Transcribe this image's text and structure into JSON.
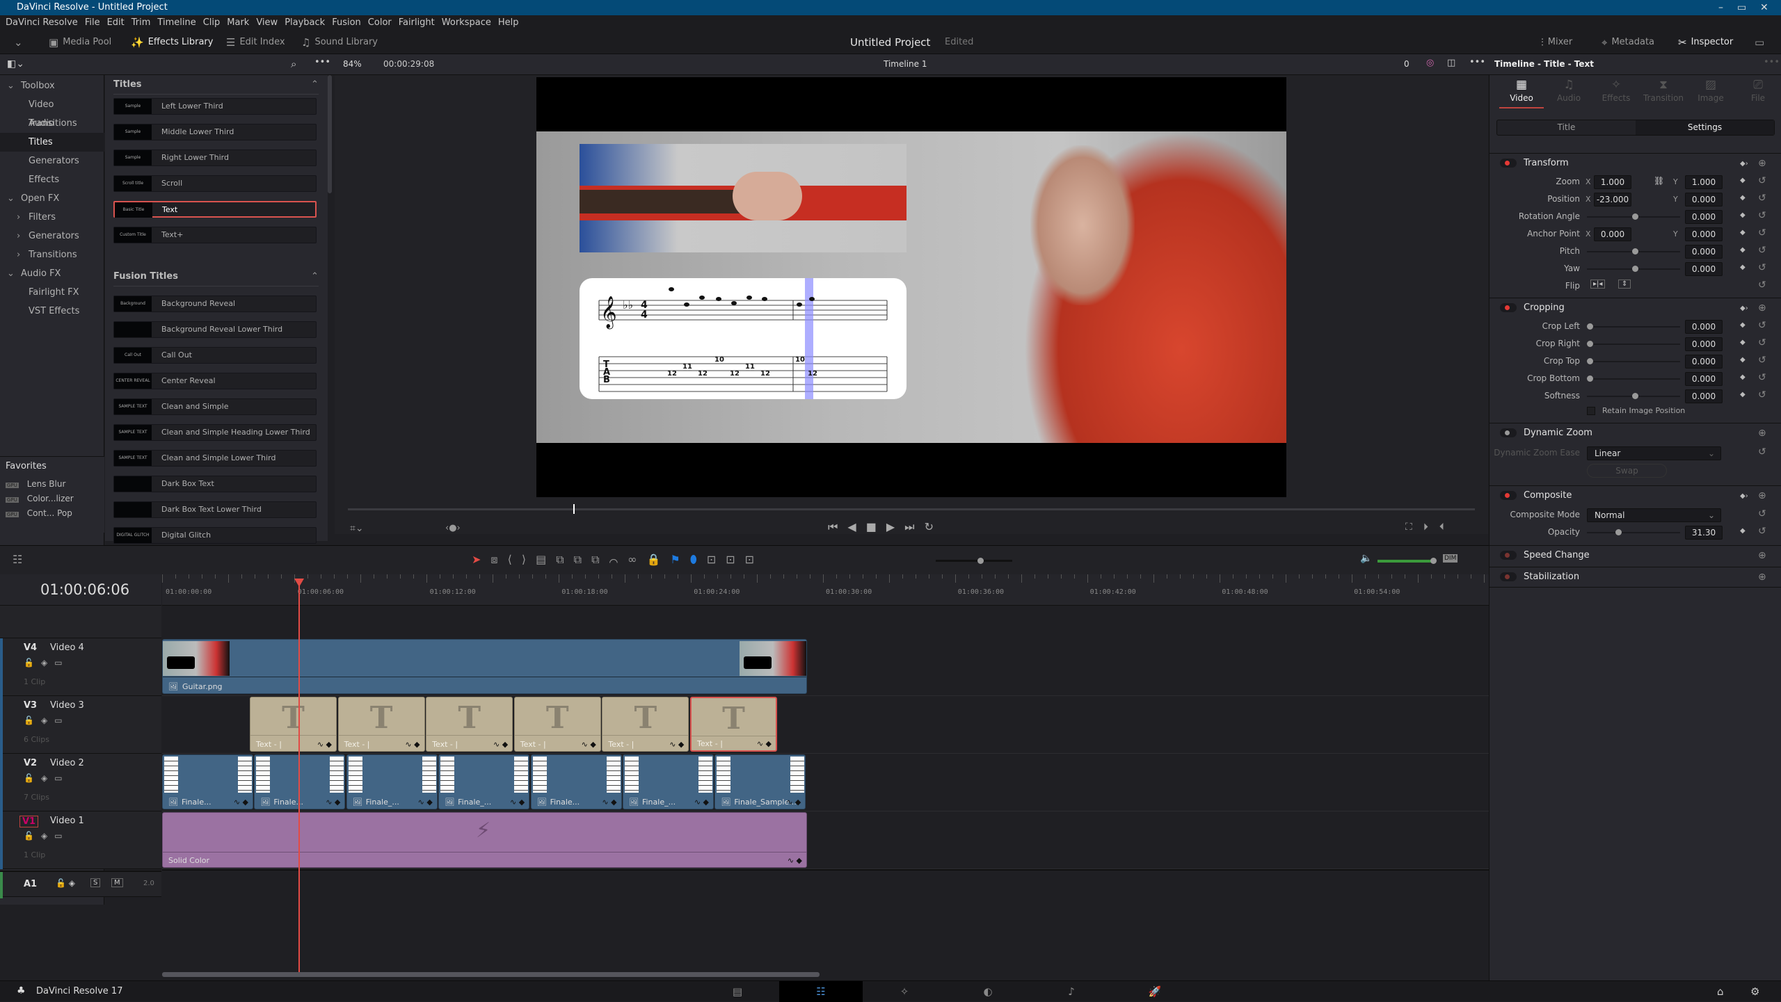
{
  "window": {
    "title": "DaVinci Resolve - Untitled Project",
    "controls": [
      "–",
      "▭",
      "✕"
    ]
  },
  "menu": [
    "DaVinci Resolve",
    "File",
    "Edit",
    "Trim",
    "Timeline",
    "Clip",
    "Mark",
    "View",
    "Playback",
    "Fusion",
    "Color",
    "Fairlight",
    "Workspace",
    "Help"
  ],
  "toolbar": {
    "media_pool": "Media Pool",
    "effects_library": "Effects Library",
    "edit_index": "Edit Index",
    "sound_library": "Sound Library",
    "project_title": "Untitled Project",
    "project_status": "Edited",
    "mixer": "Mixer",
    "metadata": "Metadata",
    "inspector": "Inspector"
  },
  "viewer": {
    "zoom": "84%",
    "duration": "00:00:29:08",
    "timeline_name": "Timeline 1",
    "counter": "0",
    "progress": 0.2
  },
  "toolbox": [
    {
      "label": "Toolbox",
      "level": 0,
      "arrow": "⌄"
    },
    {
      "label": "Video Transitions",
      "level": 2
    },
    {
      "label": "Audio Transitions",
      "level": 2
    },
    {
      "label": "Titles",
      "level": 2,
      "selected": true
    },
    {
      "label": "Generators",
      "level": 2
    },
    {
      "label": "Effects",
      "level": 2
    },
    {
      "label": "Open FX",
      "level": 0,
      "arrow": "⌄"
    },
    {
      "label": "Filters",
      "level": 1,
      "arrow": "›"
    },
    {
      "label": "Generators",
      "level": 1,
      "arrow": "›"
    },
    {
      "label": "Transitions",
      "level": 1,
      "arrow": "›"
    },
    {
      "label": "Audio FX",
      "level": 0,
      "arrow": "⌄"
    },
    {
      "label": "Fairlight FX",
      "level": 2
    },
    {
      "label": "VST Effects",
      "level": 2
    }
  ],
  "favorites": {
    "title": "Favorites",
    "items": [
      {
        "badge": "GPU",
        "label": "Lens Blur"
      },
      {
        "badge": "GPU",
        "label": "Color...lizer"
      },
      {
        "badge": "GPU",
        "label": "Cont... Pop"
      }
    ]
  },
  "effects": {
    "titles_header": "Titles",
    "titles": [
      {
        "thumb": "Sample",
        "label": "Left Lower Third"
      },
      {
        "thumb": "Sample",
        "label": "Middle Lower Third"
      },
      {
        "thumb": "Sample",
        "label": "Right Lower Third"
      },
      {
        "thumb": "Scroll title",
        "label": "Scroll"
      },
      {
        "thumb": "Basic Title",
        "label": "Text",
        "selected": true
      },
      {
        "thumb": "Custom Title",
        "label": "Text+"
      }
    ],
    "fusion_header": "Fusion Titles",
    "fusion": [
      {
        "thumb": "Background Reveal",
        "label": "Background Reveal"
      },
      {
        "thumb": "",
        "label": "Background Reveal Lower Third"
      },
      {
        "thumb": "Call Out",
        "label": "Call Out"
      },
      {
        "thumb": "CENTER REVEAL",
        "label": "Center Reveal"
      },
      {
        "thumb": "SAMPLE TEXT",
        "label": "Clean and Simple"
      },
      {
        "thumb": "SAMPLE TEXT",
        "label": "Clean and Simple Heading Lower Third"
      },
      {
        "thumb": "SAMPLE TEXT",
        "label": "Clean and Simple Lower Third"
      },
      {
        "thumb": "",
        "label": "Dark Box Text"
      },
      {
        "thumb": "",
        "label": "Dark Box Text Lower Third"
      },
      {
        "thumb": "DIGITAL GLITCH",
        "label": "Digital Glitch"
      }
    ]
  },
  "notation": {
    "tab_letters": [
      "T",
      "A",
      "B"
    ],
    "time_signature": [
      "4",
      "4"
    ],
    "tab_numbers": [
      {
        "n": "12",
        "s": 3
      },
      {
        "n": "11",
        "s": 2
      },
      {
        "n": "12",
        "s": 3
      },
      {
        "n": "10",
        "s": 1
      },
      {
        "n": "12",
        "s": 3
      },
      {
        "n": "11",
        "s": 2
      },
      {
        "n": "12",
        "s": 3
      },
      {
        "n": "10",
        "s": 1
      },
      {
        "n": "12",
        "s": 3
      }
    ],
    "highlight_color": "#8c8cff"
  },
  "inspector": {
    "header": "Timeline - Title - Text",
    "tabs": [
      {
        "label": "Video",
        "active": true,
        "icon": "film-icon"
      },
      {
        "label": "Audio",
        "icon": "music-icon"
      },
      {
        "label": "Effects",
        "icon": "wand-icon"
      },
      {
        "label": "Transition",
        "icon": "transition-icon"
      },
      {
        "label": "Image",
        "icon": "image-icon"
      },
      {
        "label": "File",
        "icon": "camera-icon"
      }
    ],
    "subtabs": [
      "Title",
      "Settings"
    ],
    "transform": {
      "title": "Transform",
      "zoom_label": "Zoom",
      "zoom_x": "1.000",
      "zoom_y": "1.000",
      "position_label": "Position",
      "position_x": "-23.000",
      "position_y": "0.000",
      "rotation_label": "Rotation Angle",
      "rotation": "0.000",
      "anchor_label": "Anchor Point",
      "anchor_x": "0.000",
      "anchor_y": "0.000",
      "pitch_label": "Pitch",
      "pitch": "0.000",
      "yaw_label": "Yaw",
      "yaw": "0.000",
      "flip_label": "Flip"
    },
    "cropping": {
      "title": "Cropping",
      "rows": [
        {
          "label": "Crop Left",
          "value": "0.000"
        },
        {
          "label": "Crop Right",
          "value": "0.000"
        },
        {
          "label": "Crop Top",
          "value": "0.000"
        },
        {
          "label": "Crop Bottom",
          "value": "0.000"
        },
        {
          "label": "Softness",
          "value": "0.000"
        }
      ],
      "retain": "Retain Image Position"
    },
    "dynamic_zoom": {
      "title": "Dynamic Zoom",
      "ease_label": "Dynamic Zoom Ease",
      "ease": "Linear",
      "swap": "Swap"
    },
    "composite": {
      "title": "Composite",
      "mode_label": "Composite Mode",
      "mode": "Normal",
      "opacity_label": "Opacity",
      "opacity": "31.30"
    },
    "speed_change": "Speed Change",
    "stabilization": "Stabilization",
    "accent": "#e53935"
  },
  "timeline": {
    "timecode": "01:00:06:06",
    "ruler": [
      "01:00:00:00",
      "01:00:06:00",
      "01:00:12:00",
      "01:00:18:00",
      "01:00:24:00",
      "01:00:30:00",
      "01:00:36:00",
      "01:00:42:00",
      "01:00:48:00",
      "01:00:54:00"
    ],
    "tracks": [
      {
        "id": "V4",
        "name": "Video 4",
        "clips_count": "1 Clip"
      },
      {
        "id": "V3",
        "name": "Video 3",
        "clips_count": "6 Clips"
      },
      {
        "id": "V2",
        "name": "Video 2",
        "clips_count": "7 Clips"
      },
      {
        "id": "V1",
        "name": "Video 1",
        "clips_count": "1 Clip"
      }
    ],
    "audio": {
      "id": "A1",
      "solo": "S",
      "mute": "M",
      "channels": "2.0"
    },
    "v4_clip": "Guitar.png",
    "v3_clips": [
      "Text - |",
      "Text - |",
      "Text - |",
      "Text - |",
      "Text - |",
      "Text - |"
    ],
    "v2_clips": [
      "Finale...",
      "Finale...",
      "Finale_...",
      "Finale_...",
      "Finale...",
      "Finale_...",
      "Finale_Sample..."
    ],
    "v1_clip": "Solid Color"
  },
  "status": {
    "app": "DaVinci Resolve 17"
  }
}
